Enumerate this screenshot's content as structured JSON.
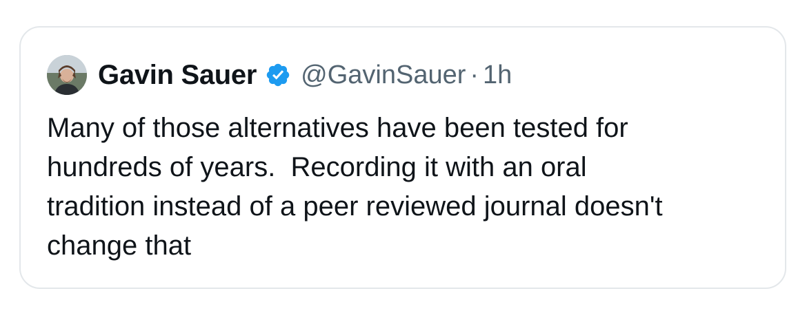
{
  "tweet": {
    "author_name": "Gavin Sauer",
    "handle": "@GavinSauer",
    "separator": "·",
    "time": "1h",
    "verified": true,
    "text": "Many of those alternatives have been tested for\nhundreds of years.  Recording it with an oral\ntradition instead of a peer reviewed journal doesn't\nchange that"
  },
  "icons": {
    "avatar": "profile-photo",
    "verified": "verified-badge-icon"
  },
  "colors": {
    "name": "#0f1419",
    "secondary": "#536471",
    "verified_badge": "#1d9bf0",
    "border": "#e3e7ea"
  }
}
